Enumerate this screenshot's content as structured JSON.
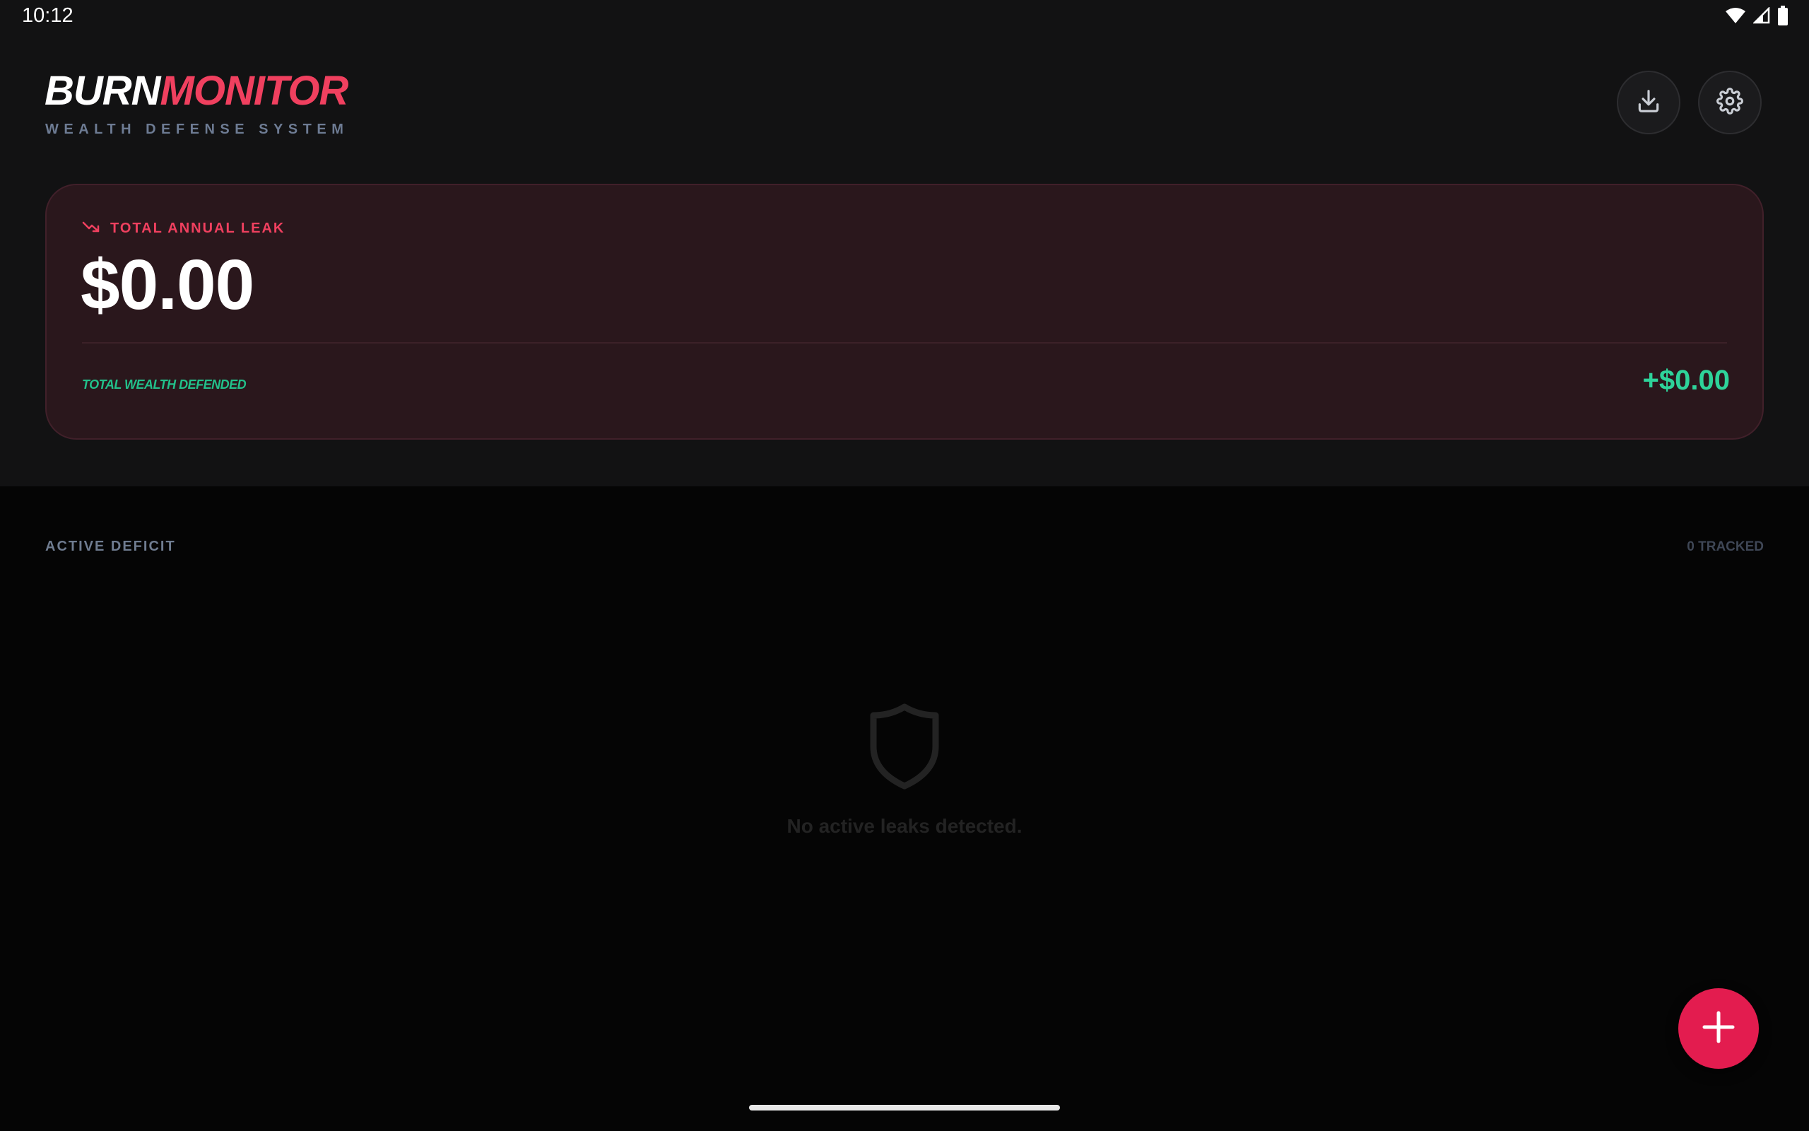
{
  "status_bar": {
    "time": "10:12",
    "icons": [
      "wifi-icon",
      "cell-signal-icon",
      "battery-icon"
    ]
  },
  "header": {
    "brand_part1": "BURN",
    "brand_part2": "MONITOR",
    "tagline": "WEALTH DEFENSE SYSTEM",
    "actions": [
      "download-icon",
      "settings-icon"
    ]
  },
  "summary_card": {
    "label": "TOTAL ANNUAL LEAK",
    "amount": "$0.00",
    "defended_label": "TOTAL WEALTH DEFENDED",
    "defended_amount": "+$0.00"
  },
  "list": {
    "title": "ACTIVE DEFICIT",
    "count": "0 TRACKED",
    "empty_message": "No active leaks detected."
  },
  "colors": {
    "accent": "#f0405f",
    "positive": "#2ed39a",
    "fab": "#e31c4f",
    "panel": "#121213",
    "background": "#050505"
  }
}
